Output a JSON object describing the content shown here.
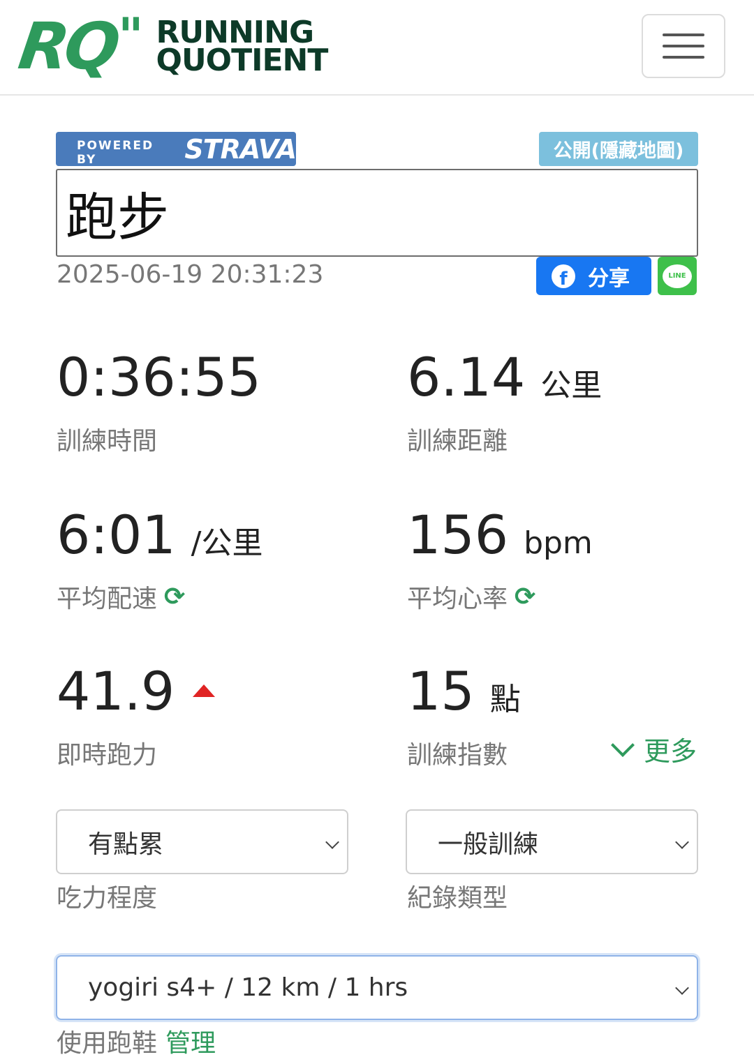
{
  "header": {
    "logo_rq": "RQ",
    "logo_quote": "\"",
    "logo_line1": "RUNNING",
    "logo_line2": "QUOTIENT",
    "menu_icon": "hamburger-icon"
  },
  "activity": {
    "powered_by": "POWERED BY",
    "strava_brand": "STRAVA",
    "visibility": "公開(隱藏地圖)",
    "title": "跑步",
    "datetime": "2025-06-19 20:31:23",
    "share_label": "分享",
    "facebook_glyph": "f",
    "line_glyph": "LINE"
  },
  "stats": {
    "duration": {
      "value": "0:36:55",
      "label": "訓練時間"
    },
    "distance": {
      "value": "6.14",
      "unit": "公里",
      "label": "訓練距離"
    },
    "pace": {
      "value": "6:01",
      "unit": "/公里",
      "label": "平均配速"
    },
    "heart_rate": {
      "value": "156",
      "unit": "bpm",
      "label": "平均心率"
    },
    "running_power": {
      "value": "41.9",
      "label": "即時跑力",
      "trend_icon": "triangle-up-icon",
      "trend_color": "#e02424"
    },
    "training_index": {
      "value": "15",
      "unit": "點",
      "label": "訓練指數"
    },
    "sync_glyph": "⟳"
  },
  "more": {
    "label": "更多"
  },
  "effort": {
    "selected": "有點累",
    "label": "吃力程度"
  },
  "record_type": {
    "selected": "一般訓練",
    "label": "紀錄類型"
  },
  "shoes": {
    "selected": "yogiri s4+ / 12 km / 1 hrs",
    "label": "使用跑鞋",
    "manage_label": "管理"
  },
  "colors": {
    "accent": "#2e9a5c",
    "strava": "#4a7bbb",
    "public_badge": "#7cc0dd",
    "facebook": "#1877f2",
    "line": "#3ec04a"
  }
}
